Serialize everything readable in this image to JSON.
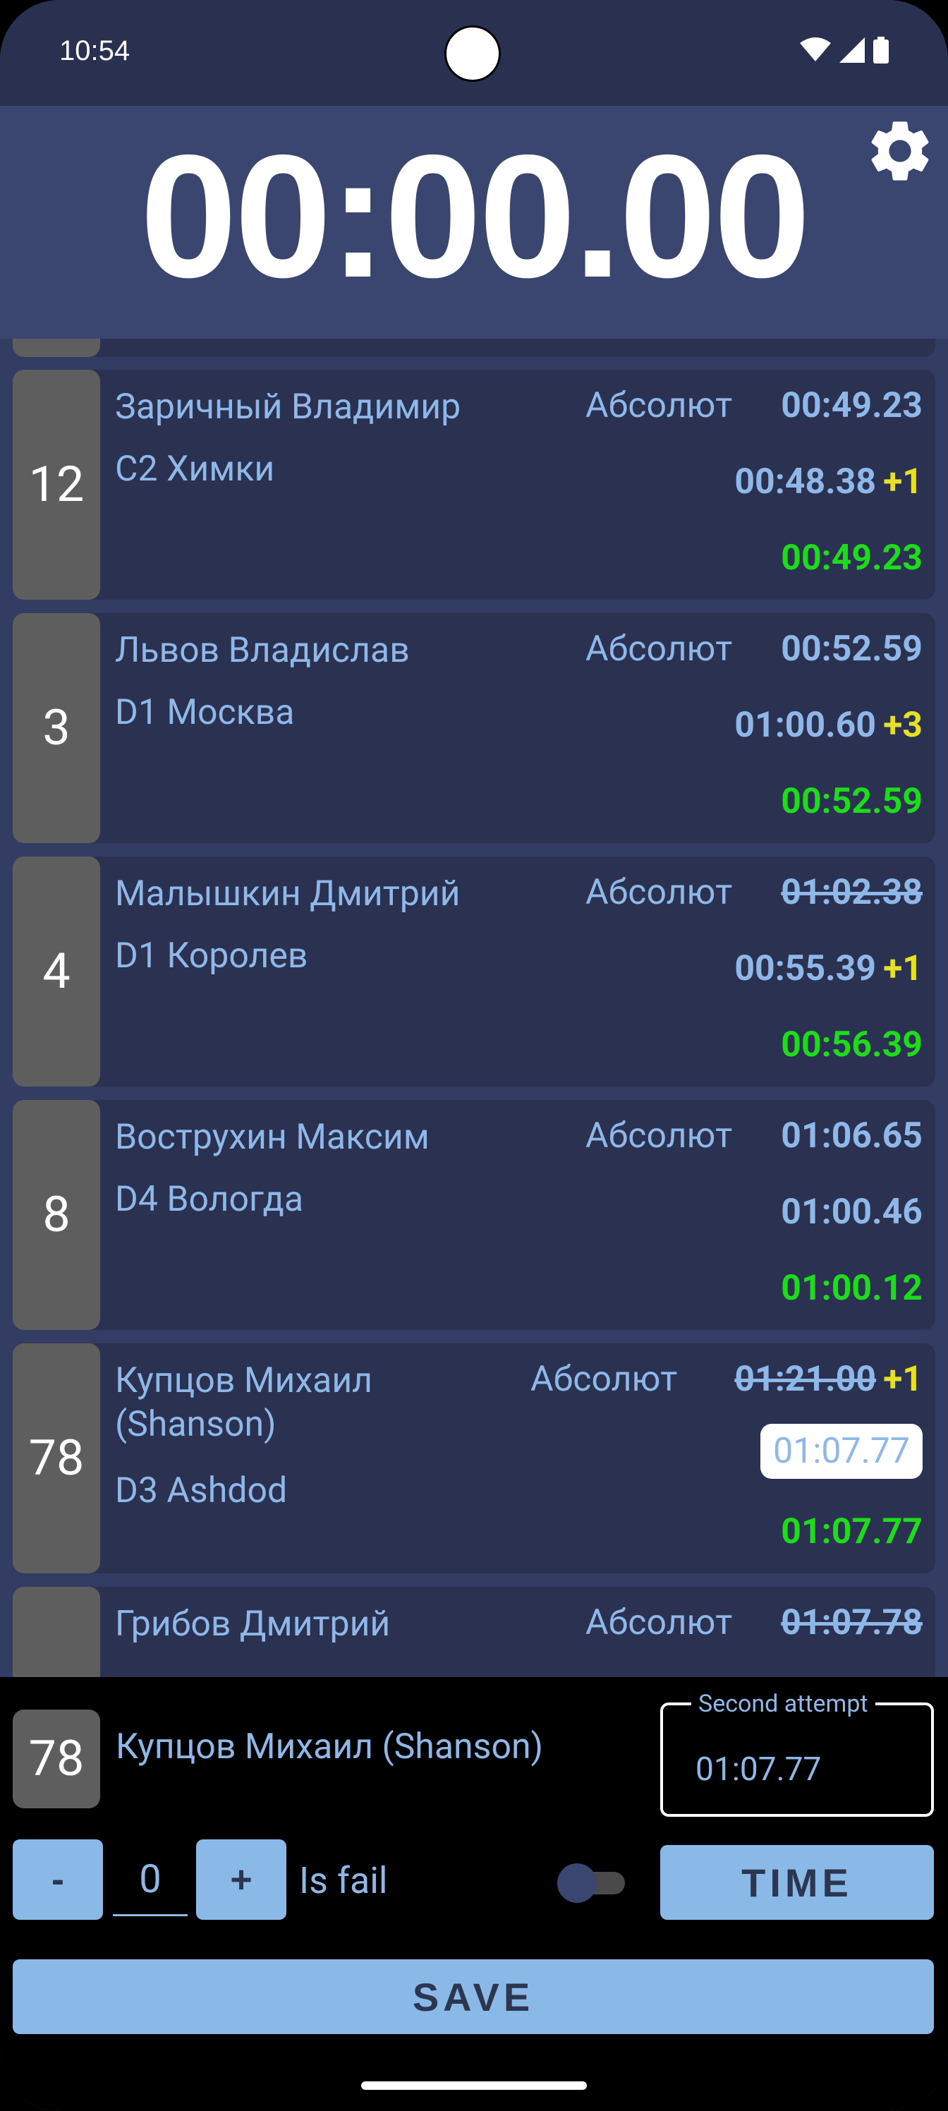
{
  "status_bar": {
    "time": "10:54"
  },
  "stopwatch": {
    "value": "00:00.00"
  },
  "entries": [
    {
      "number": "12",
      "name": "Заричный Владимир",
      "team": "С2 Химки",
      "category": "Абсолют",
      "time1": "00:49.23",
      "time1_struck": false,
      "time1_penalty": "",
      "time2": "00:48.38",
      "time2_penalty": "+1",
      "best": "00:49.23"
    },
    {
      "number": "3",
      "name": "Львов Владислав",
      "team": "D1 Москва",
      "category": "Абсолют",
      "time1": "00:52.59",
      "time1_struck": false,
      "time1_penalty": "",
      "time2": "01:00.60",
      "time2_penalty": "+3",
      "best": "00:52.59"
    },
    {
      "number": "4",
      "name": "Малышкин Дмитрий",
      "team": "D1 Королев",
      "category": "Абсолют",
      "time1": "01:02.38",
      "time1_struck": true,
      "time1_penalty": "",
      "time2": "00:55.39",
      "time2_penalty": "+1",
      "best": "00:56.39"
    },
    {
      "number": "8",
      "name": "Вострухин Максим",
      "team": "D4 Вологда",
      "category": "Абсолют",
      "time1": "01:06.65",
      "time1_struck": false,
      "time1_penalty": "",
      "time2": "01:00.46",
      "time2_penalty": "",
      "best": "01:00.12"
    },
    {
      "number": "78",
      "name": "Купцов Михаил (Shanson)",
      "team": "D3 Ashdod",
      "category": "Абсолют",
      "time1": "01:21.00",
      "time1_struck": true,
      "time1_penalty": "+1",
      "time2": "01:07.77",
      "time2_penalty": "",
      "best": "01:07.77"
    },
    {
      "number": "",
      "name": "Грибов Дмитрий",
      "team": "",
      "category": "Абсолют",
      "time1": "01:07.78",
      "time1_struck": true,
      "time1_penalty": "",
      "time2": "",
      "time2_penalty": "",
      "best": ""
    }
  ],
  "editor": {
    "number": "78",
    "name": "Купцов Михаил (Shanson)",
    "attempt_label": "Second attempt",
    "attempt_value": "01:07.77",
    "minus_label": "-",
    "penalty_value": "0",
    "plus_label": "+",
    "is_fail_label": "Is fail",
    "is_fail": false,
    "time_label": "TIME",
    "save_label": "SAVE"
  },
  "colors": {
    "background": "#333d63",
    "card": "#2a3151",
    "text": "#8fb8e8",
    "best": "#1edb1e",
    "penalty": "#e6e026",
    "button": "#8ab9e8"
  }
}
